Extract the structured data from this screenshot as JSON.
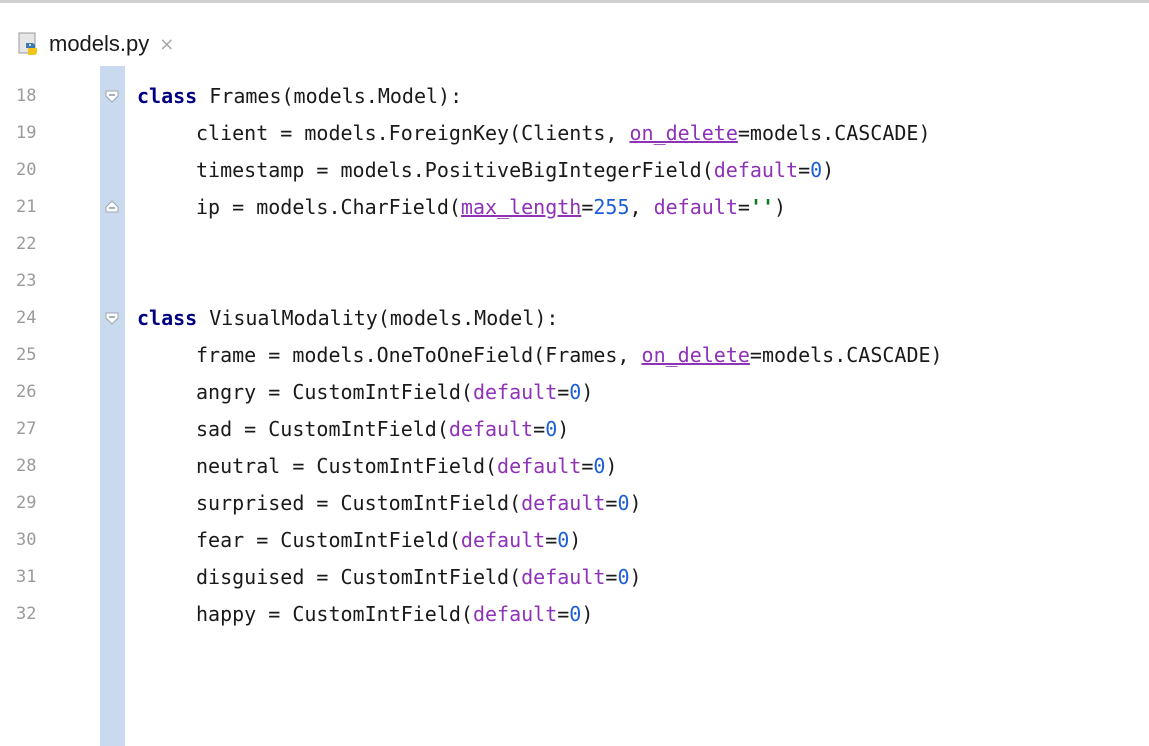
{
  "tab": {
    "title": "models.py",
    "close_glyph": "×",
    "icon": "python-file-icon"
  },
  "colors": {
    "tab_underline": "#4a88c7",
    "fold_gutter": "#c9daee",
    "keyword": "#000080",
    "param": "#8e32b8",
    "number": "#1b5fd8",
    "string": "#067d17"
  },
  "lines": [
    {
      "n": "18",
      "fold": "open",
      "tokens": [
        {
          "t": "class",
          "c": "kw"
        },
        {
          "t": " Frames(models.Model):",
          "c": ""
        }
      ]
    },
    {
      "n": "19",
      "tokens": [
        {
          "t": "client = models.ForeignKey(Clients, ",
          "c": ""
        },
        {
          "t": "on_delete",
          "c": "param ul"
        },
        {
          "t": "=models.CASCADE)",
          "c": ""
        }
      ]
    },
    {
      "n": "20",
      "tokens": [
        {
          "t": "timestamp = models.PositiveBigIntegerField(",
          "c": ""
        },
        {
          "t": "default",
          "c": "param"
        },
        {
          "t": "=",
          "c": ""
        },
        {
          "t": "0",
          "c": "num"
        },
        {
          "t": ")",
          "c": ""
        }
      ]
    },
    {
      "n": "21",
      "fold": "close",
      "tokens": [
        {
          "t": "ip = models.CharField(",
          "c": ""
        },
        {
          "t": "max_length",
          "c": "param ul"
        },
        {
          "t": "=",
          "c": ""
        },
        {
          "t": "255",
          "c": "num"
        },
        {
          "t": ", ",
          "c": ""
        },
        {
          "t": "default",
          "c": "param"
        },
        {
          "t": "=",
          "c": ""
        },
        {
          "t": "''",
          "c": "str"
        },
        {
          "t": ")",
          "c": ""
        }
      ]
    },
    {
      "n": "22",
      "tokens": []
    },
    {
      "n": "23",
      "tokens": []
    },
    {
      "n": "24",
      "fold": "open",
      "tokens": [
        {
          "t": "class",
          "c": "kw"
        },
        {
          "t": " VisualModality(models.Model):",
          "c": ""
        }
      ]
    },
    {
      "n": "25",
      "tokens": [
        {
          "t": "frame = models.OneToOneField(Frames, ",
          "c": ""
        },
        {
          "t": "on_delete",
          "c": "param ul"
        },
        {
          "t": "=models.CASCADE)",
          "c": ""
        }
      ]
    },
    {
      "n": "26",
      "tokens": [
        {
          "t": "angry = CustomIntField(",
          "c": ""
        },
        {
          "t": "default",
          "c": "param"
        },
        {
          "t": "=",
          "c": ""
        },
        {
          "t": "0",
          "c": "num"
        },
        {
          "t": ")",
          "c": ""
        }
      ]
    },
    {
      "n": "27",
      "tokens": [
        {
          "t": "sad = CustomIntField(",
          "c": ""
        },
        {
          "t": "default",
          "c": "param"
        },
        {
          "t": "=",
          "c": ""
        },
        {
          "t": "0",
          "c": "num"
        },
        {
          "t": ")",
          "c": ""
        }
      ]
    },
    {
      "n": "28",
      "tokens": [
        {
          "t": "neutral = CustomIntField(",
          "c": ""
        },
        {
          "t": "default",
          "c": "param"
        },
        {
          "t": "=",
          "c": ""
        },
        {
          "t": "0",
          "c": "num"
        },
        {
          "t": ")",
          "c": ""
        }
      ]
    },
    {
      "n": "29",
      "tokens": [
        {
          "t": "surprised = CustomIntField(",
          "c": ""
        },
        {
          "t": "default",
          "c": "param"
        },
        {
          "t": "=",
          "c": ""
        },
        {
          "t": "0",
          "c": "num"
        },
        {
          "t": ")",
          "c": ""
        }
      ]
    },
    {
      "n": "30",
      "tokens": [
        {
          "t": "fear = CustomIntField(",
          "c": ""
        },
        {
          "t": "default",
          "c": "param"
        },
        {
          "t": "=",
          "c": ""
        },
        {
          "t": "0",
          "c": "num"
        },
        {
          "t": ")",
          "c": ""
        }
      ]
    },
    {
      "n": "31",
      "tokens": [
        {
          "t": "disguised = CustomIntField(",
          "c": ""
        },
        {
          "t": "default",
          "c": "param"
        },
        {
          "t": "=",
          "c": ""
        },
        {
          "t": "0",
          "c": "num"
        },
        {
          "t": ")",
          "c": ""
        }
      ]
    },
    {
      "n": "32",
      "tokens": [
        {
          "t": "happy = CustomIntField(",
          "c": ""
        },
        {
          "t": "default",
          "c": "param"
        },
        {
          "t": "=",
          "c": ""
        },
        {
          "t": "0",
          "c": "num"
        },
        {
          "t": ")",
          "c": ""
        }
      ]
    }
  ]
}
